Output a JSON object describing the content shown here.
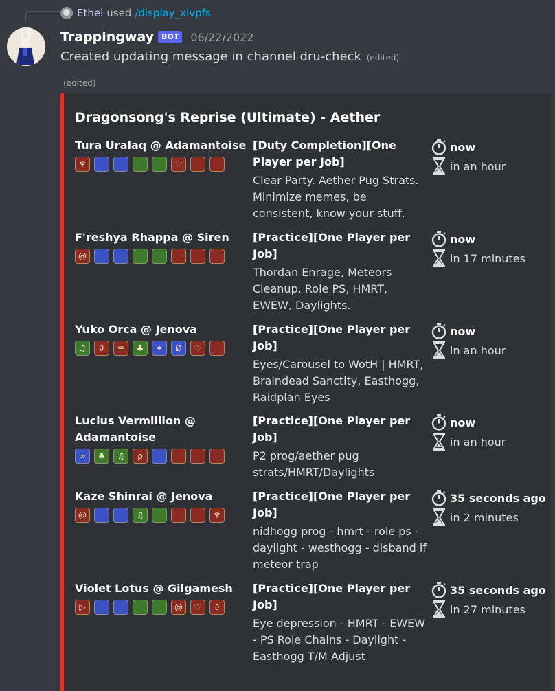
{
  "reply": {
    "user": "Ethel",
    "used": "used",
    "command": "/display_xivpfs"
  },
  "message": {
    "username": "Trappingway",
    "bot_tag": "BOT",
    "timestamp": "06/22/2022",
    "content": "Created updating message in channel dru-check",
    "edited": "(edited)",
    "edited2": "(edited)"
  },
  "embed": {
    "accent_color": "#e23028",
    "title": "Dragonsong's Reprise (Ultimate) - Aether",
    "listings": [
      {
        "player": "Tura Uralaq @ Adamantoise",
        "jobs": [
          {
            "color": "red",
            "glyph": "♆",
            "icon": "dragoon-job-icon"
          },
          {
            "color": "blue",
            "glyph": "",
            "icon": "tank-slot-icon"
          },
          {
            "color": "blue",
            "glyph": "",
            "icon": "tank-slot-icon"
          },
          {
            "color": "green",
            "glyph": "",
            "icon": "healer-slot-icon"
          },
          {
            "color": "green",
            "glyph": "",
            "icon": "healer-slot-icon"
          },
          {
            "color": "red",
            "glyph": "♡",
            "icon": "ninja-job-icon"
          },
          {
            "color": "red",
            "glyph": "",
            "icon": "dps-slot-icon"
          },
          {
            "color": "red",
            "glyph": "",
            "icon": "dps-slot-icon"
          }
        ],
        "title": "[Duty Completion][One Player per Job]",
        "description": "Clear Party. Aether Pug Strats. Minimize memes, be consistent, know your stuff.",
        "started": "now",
        "expires": "in an hour"
      },
      {
        "player": "F'reshya Rhappa @ Siren",
        "jobs": [
          {
            "color": "red",
            "glyph": "@",
            "icon": "monk-job-icon"
          },
          {
            "color": "blue",
            "glyph": "",
            "icon": "tank-slot-icon"
          },
          {
            "color": "blue",
            "glyph": "",
            "icon": "tank-slot-icon"
          },
          {
            "color": "green",
            "glyph": "",
            "icon": "healer-slot-icon"
          },
          {
            "color": "green",
            "glyph": "",
            "icon": "healer-slot-icon"
          },
          {
            "color": "red",
            "glyph": "",
            "icon": "dps-slot-icon"
          },
          {
            "color": "red",
            "glyph": "",
            "icon": "dps-slot-icon"
          },
          {
            "color": "red",
            "glyph": "",
            "icon": "dps-slot-icon"
          }
        ],
        "title": "[Practice][One Player per Job]",
        "description": "Thordan Enrage, Meteors Cleanup. Role PS, HMRT, EWEW, Daylights.",
        "started": "now",
        "expires": "in 17 minutes"
      },
      {
        "player": "Yuko Orca @ Jenova",
        "jobs": [
          {
            "color": "green",
            "glyph": "♫",
            "icon": "scholar-job-icon"
          },
          {
            "color": "red",
            "glyph": "∂",
            "icon": "bard-job-icon"
          },
          {
            "color": "red",
            "glyph": "≡",
            "icon": "reaper-job-icon"
          },
          {
            "color": "green",
            "glyph": "♣",
            "icon": "astrologian-job-icon"
          },
          {
            "color": "blue",
            "glyph": "✶",
            "icon": "paladin-job-icon"
          },
          {
            "color": "blue",
            "glyph": "Ø",
            "icon": "gunbreaker-job-icon"
          },
          {
            "color": "red",
            "glyph": "♡",
            "icon": "ninja-job-icon"
          },
          {
            "color": "red",
            "glyph": "",
            "icon": "dps-slot-icon"
          }
        ],
        "title": "[Practice][One Player per Job]",
        "description": "Eyes/Carousel to WotH | HMRT, Braindead Sanctity, Easthogg, Raidplan Eyes",
        "started": "now",
        "expires": "in an hour"
      },
      {
        "player": "Lucius Vermillion @ Adamantoise",
        "jobs": [
          {
            "color": "blue",
            "glyph": "∞",
            "icon": "warrior-job-icon"
          },
          {
            "color": "green",
            "glyph": "♣",
            "icon": "astrologian-job-icon"
          },
          {
            "color": "green",
            "glyph": "♫",
            "icon": "scholar-job-icon"
          },
          {
            "color": "red",
            "glyph": "ρ",
            "icon": "red-mage-job-icon"
          },
          {
            "color": "blue",
            "glyph": "",
            "icon": "tank-slot-icon"
          },
          {
            "color": "red",
            "glyph": "",
            "icon": "dps-slot-icon"
          },
          {
            "color": "red",
            "glyph": "",
            "icon": "dps-slot-icon"
          },
          {
            "color": "red",
            "glyph": "",
            "icon": "dps-slot-icon"
          }
        ],
        "title": "[Practice][One Player per Job]",
        "description": "P2 prog/aether pug strats/HMRT/Daylights",
        "started": "now",
        "expires": "in an hour"
      },
      {
        "player": "Kaze Shinrai @ Jenova",
        "jobs": [
          {
            "color": "red",
            "glyph": "@",
            "icon": "monk-job-icon"
          },
          {
            "color": "blue",
            "glyph": "",
            "icon": "tank-slot-icon"
          },
          {
            "color": "blue",
            "glyph": "",
            "icon": "tank-slot-icon"
          },
          {
            "color": "green",
            "glyph": "♫",
            "icon": "scholar-job-icon"
          },
          {
            "color": "green",
            "glyph": "",
            "icon": "healer-slot-icon"
          },
          {
            "color": "red",
            "glyph": "",
            "icon": "dps-slot-icon"
          },
          {
            "color": "red",
            "glyph": "",
            "icon": "dps-slot-icon"
          },
          {
            "color": "red",
            "glyph": "♆",
            "icon": "dragoon-job-icon"
          }
        ],
        "title": "[Practice][One Player per Job]",
        "description": "nidhogg prog - hmrt - role ps - daylight - westhogg - disband if meteor trap",
        "started": "35 seconds ago",
        "expires": "in 2 minutes"
      },
      {
        "player": "Violet Lotus @ Gilgamesh",
        "jobs": [
          {
            "color": "red",
            "glyph": "▷",
            "icon": "dancer-job-icon"
          },
          {
            "color": "blue",
            "glyph": "",
            "icon": "tank-slot-icon"
          },
          {
            "color": "blue",
            "glyph": "",
            "icon": "tank-slot-icon"
          },
          {
            "color": "green",
            "glyph": "",
            "icon": "healer-slot-icon"
          },
          {
            "color": "green",
            "glyph": "",
            "icon": "healer-slot-icon"
          },
          {
            "color": "red",
            "glyph": "@",
            "icon": "monk-job-icon"
          },
          {
            "color": "red",
            "glyph": "♡",
            "icon": "ninja-job-icon"
          },
          {
            "color": "red",
            "glyph": "∂",
            "icon": "bard-job-icon"
          }
        ],
        "title": "[Practice][One Player per Job]",
        "description": "Eye depression - HMRT - EWEW - PS Role Chains - Daylight - Easthogg T/M Adjust",
        "started": "35 seconds ago",
        "expires": "in 27 minutes"
      }
    ]
  }
}
